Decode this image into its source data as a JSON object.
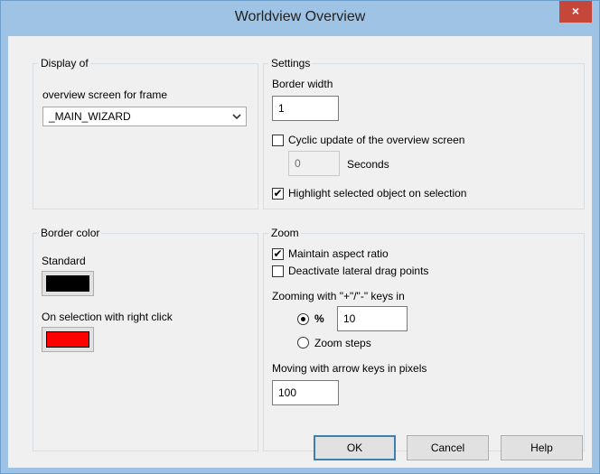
{
  "window": {
    "title": "Worldview Overview",
    "close_glyph": "×"
  },
  "display_of": {
    "title": "Display of",
    "label": "overview screen for frame",
    "selected": "_MAIN_WIZARD"
  },
  "settings": {
    "title": "Settings",
    "border_width_label": "Border width",
    "border_width_value": "1",
    "cyclic_update_label": "Cyclic update of the overview screen",
    "cyclic_update_checked": false,
    "seconds_value": "0",
    "seconds_label": "Seconds",
    "highlight_label": "Highlight selected object on selection",
    "highlight_checked": true
  },
  "border_color": {
    "title": "Border color",
    "standard_label": "Standard",
    "standard_color": "#000000",
    "selection_label": "On selection with right click",
    "selection_color": "#ff0000"
  },
  "zoom": {
    "title": "Zoom",
    "aspect_label": "Maintain aspect ratio",
    "aspect_checked": true,
    "drag_points_label": "Deactivate lateral drag points",
    "drag_points_checked": false,
    "zoom_keys_label": "Zooming with \"+\"/\"-\" keys in",
    "percent_label": "%",
    "percent_selected": true,
    "percent_value": "10",
    "zoom_steps_label": "Zoom steps",
    "arrow_keys_label": "Moving with arrow keys in pixels",
    "arrow_keys_value": "100"
  },
  "buttons": {
    "ok": "OK",
    "cancel": "Cancel",
    "help": "Help"
  },
  "icons": {
    "check": "check-icon",
    "dropdown": "chevron-down-icon",
    "close": "close-icon"
  }
}
